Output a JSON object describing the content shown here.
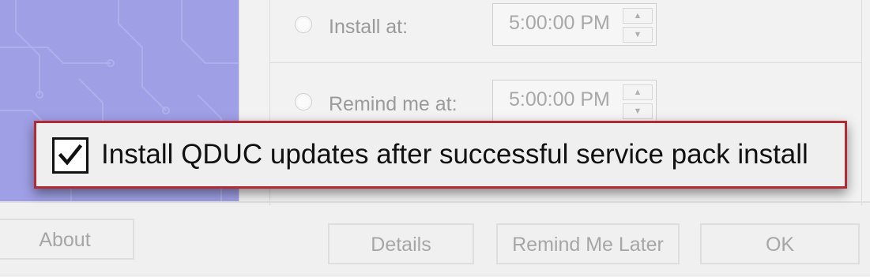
{
  "schedule": {
    "install_at_label": "Install at:",
    "install_at_time": "5:00:00 PM",
    "remind_me_label": "Remind me at:",
    "remind_me_time": "5:00:00 PM"
  },
  "callout": {
    "checkbox_checked": true,
    "checkbox_label": "Install QDUC updates after successful service pack install"
  },
  "buttons": {
    "about": "About",
    "details": "Details",
    "remind_later": "Remind Me Later",
    "ok": "OK"
  },
  "icons": {
    "spin_up": "▲",
    "spin_down": "▼",
    "checkmark": "check-icon"
  },
  "colors": {
    "callout_border": "#b22a34",
    "side_art": "#9f9fe6"
  }
}
